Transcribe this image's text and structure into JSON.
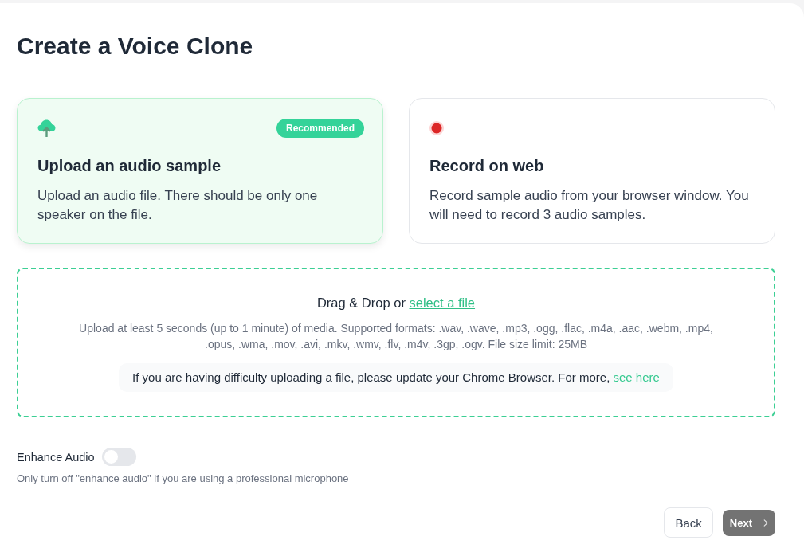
{
  "title": "Create a Voice Clone",
  "options": [
    {
      "kind": "upload",
      "title": "Upload an audio sample",
      "description": "Upload an audio file. There should be only one speaker on the file.",
      "badge": "Recommended",
      "selected": true
    },
    {
      "kind": "record",
      "title": "Record on web",
      "description": "Record sample audio from your browser window. You will need to record 3 audio samples.",
      "selected": false
    }
  ],
  "dropzone": {
    "prompt": "Drag & Drop or",
    "link": "select a file",
    "formats": "Upload at least 5 seconds (up to 1 minute) of media. Supported formats: .wav, .wave, .mp3, .ogg, .flac, .m4a, .aac, .webm, .mp4, .opus, .wma, .mov, .avi, .mkv, .wmv, .flv, .m4v, .3gp, .ogv. File size limit: 25MB",
    "note": {
      "text": "If you are having difficulty uploading a file, please update your Chrome Browser. For more,",
      "link": "see here"
    }
  },
  "enhance_audio": {
    "label": "Enhance Audio",
    "on": false,
    "hint": "Only turn off \"enhance audio\" if you are using a professional microphone"
  },
  "buttons": [
    {
      "label": "Back",
      "kind": "secondary"
    },
    {
      "label": "Next",
      "kind": "primary",
      "disabled": true
    }
  ]
}
